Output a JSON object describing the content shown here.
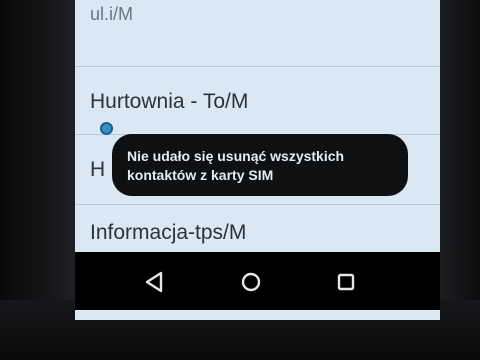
{
  "list": {
    "top_partial": "ul.i/M",
    "item1": "Hurtownia - To/M",
    "item2_partial": "H",
    "item3": "Informacja-tps/M"
  },
  "toast": {
    "line1": "Nie udało się usunąć wszystkich",
    "line2": "kontaktów z karty SIM"
  },
  "nav": {
    "back_icon": "back-triangle-icon",
    "home_icon": "home-circle-icon",
    "recent_icon": "recent-apps-square-icon"
  }
}
